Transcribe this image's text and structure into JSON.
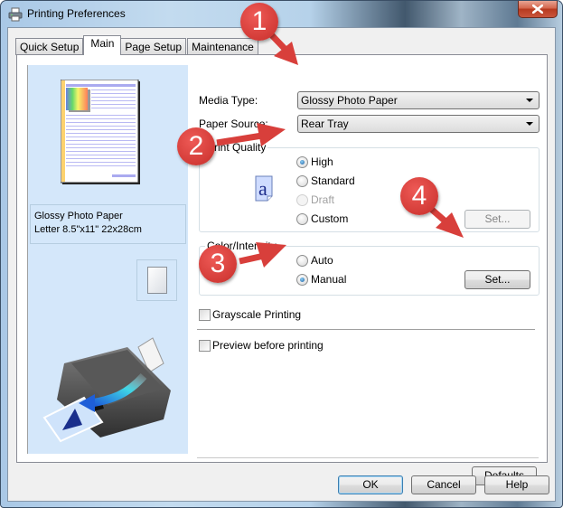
{
  "window": {
    "title": "Printing Preferences"
  },
  "tabs": [
    {
      "label": "Quick Setup",
      "active": false
    },
    {
      "label": "Main",
      "active": true
    },
    {
      "label": "Page Setup",
      "active": false
    },
    {
      "label": "Maintenance",
      "active": false
    }
  ],
  "preview": {
    "paper_name": "Glossy Photo Paper",
    "paper_size": "Letter 8.5\"x11\" 22x28cm"
  },
  "media_type": {
    "label": "Media Type:",
    "value": "Glossy Photo Paper"
  },
  "paper_source": {
    "label": "Paper Source:",
    "value": "Rear Tray"
  },
  "print_quality": {
    "title": "Print Quality",
    "options": [
      {
        "label": "High",
        "checked": true,
        "disabled": false
      },
      {
        "label": "Standard",
        "checked": false,
        "disabled": false
      },
      {
        "label": "Draft",
        "checked": false,
        "disabled": true
      },
      {
        "label": "Custom",
        "checked": false,
        "disabled": false
      }
    ],
    "set_button": "Set...",
    "icon_letter": "a"
  },
  "color_intensity": {
    "title": "Color/Intensity",
    "options": [
      {
        "label": "Auto",
        "checked": false
      },
      {
        "label": "Manual",
        "checked": true
      }
    ],
    "set_button": "Set..."
  },
  "checkboxes": {
    "grayscale": {
      "label": "Grayscale Printing",
      "checked": false
    },
    "preview": {
      "label": "Preview before printing",
      "checked": false
    }
  },
  "buttons": {
    "defaults": "Defaults",
    "ok": "OK",
    "cancel": "Cancel",
    "help": "Help"
  },
  "annotations": {
    "step1": "1",
    "step2": "2",
    "step3": "3",
    "step4": "4",
    "color": "#d83f3b"
  }
}
